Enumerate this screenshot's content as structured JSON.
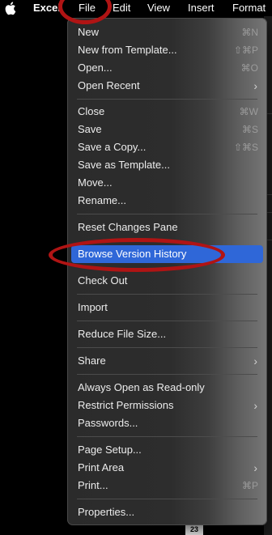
{
  "menubar": {
    "apple_icon": "apple-logo-icon",
    "app": "Excel",
    "items": [
      "File",
      "Edit",
      "View",
      "Insert",
      "Format"
    ]
  },
  "file_menu": {
    "items": [
      {
        "label": "New",
        "shortcut": "⌘N"
      },
      {
        "label": "New from Template...",
        "shortcut": "⇧⌘P"
      },
      {
        "label": "Open...",
        "shortcut": "⌘O"
      },
      {
        "label": "Open Recent",
        "submenu": true
      },
      {
        "label": "Close",
        "shortcut": "⌘W"
      },
      {
        "label": "Save",
        "shortcut": "⌘S"
      },
      {
        "label": "Save a Copy...",
        "shortcut": "⇧⌘S"
      },
      {
        "label": "Save as Template..."
      },
      {
        "label": "Move..."
      },
      {
        "label": "Rename..."
      },
      {
        "label": "Reset Changes Pane"
      },
      {
        "label": "Browse Version History",
        "highlighted": true
      },
      {
        "label": "Check Out"
      },
      {
        "label": "Import"
      },
      {
        "label": "Reduce File Size..."
      },
      {
        "label": "Share",
        "submenu": true
      },
      {
        "label": "Always Open as Read-only"
      },
      {
        "label": "Restrict Permissions",
        "submenu": true
      },
      {
        "label": "Passwords..."
      },
      {
        "label": "Page Setup..."
      },
      {
        "label": "Print Area",
        "submenu": true
      },
      {
        "label": "Print...",
        "shortcut": "⌘P"
      },
      {
        "label": "Properties..."
      }
    ],
    "submenu_icon": "chevron-right-icon"
  },
  "background": {
    "row_number": "23"
  },
  "colors": {
    "highlight": "#2f67d8",
    "annotation": "#b01414"
  }
}
